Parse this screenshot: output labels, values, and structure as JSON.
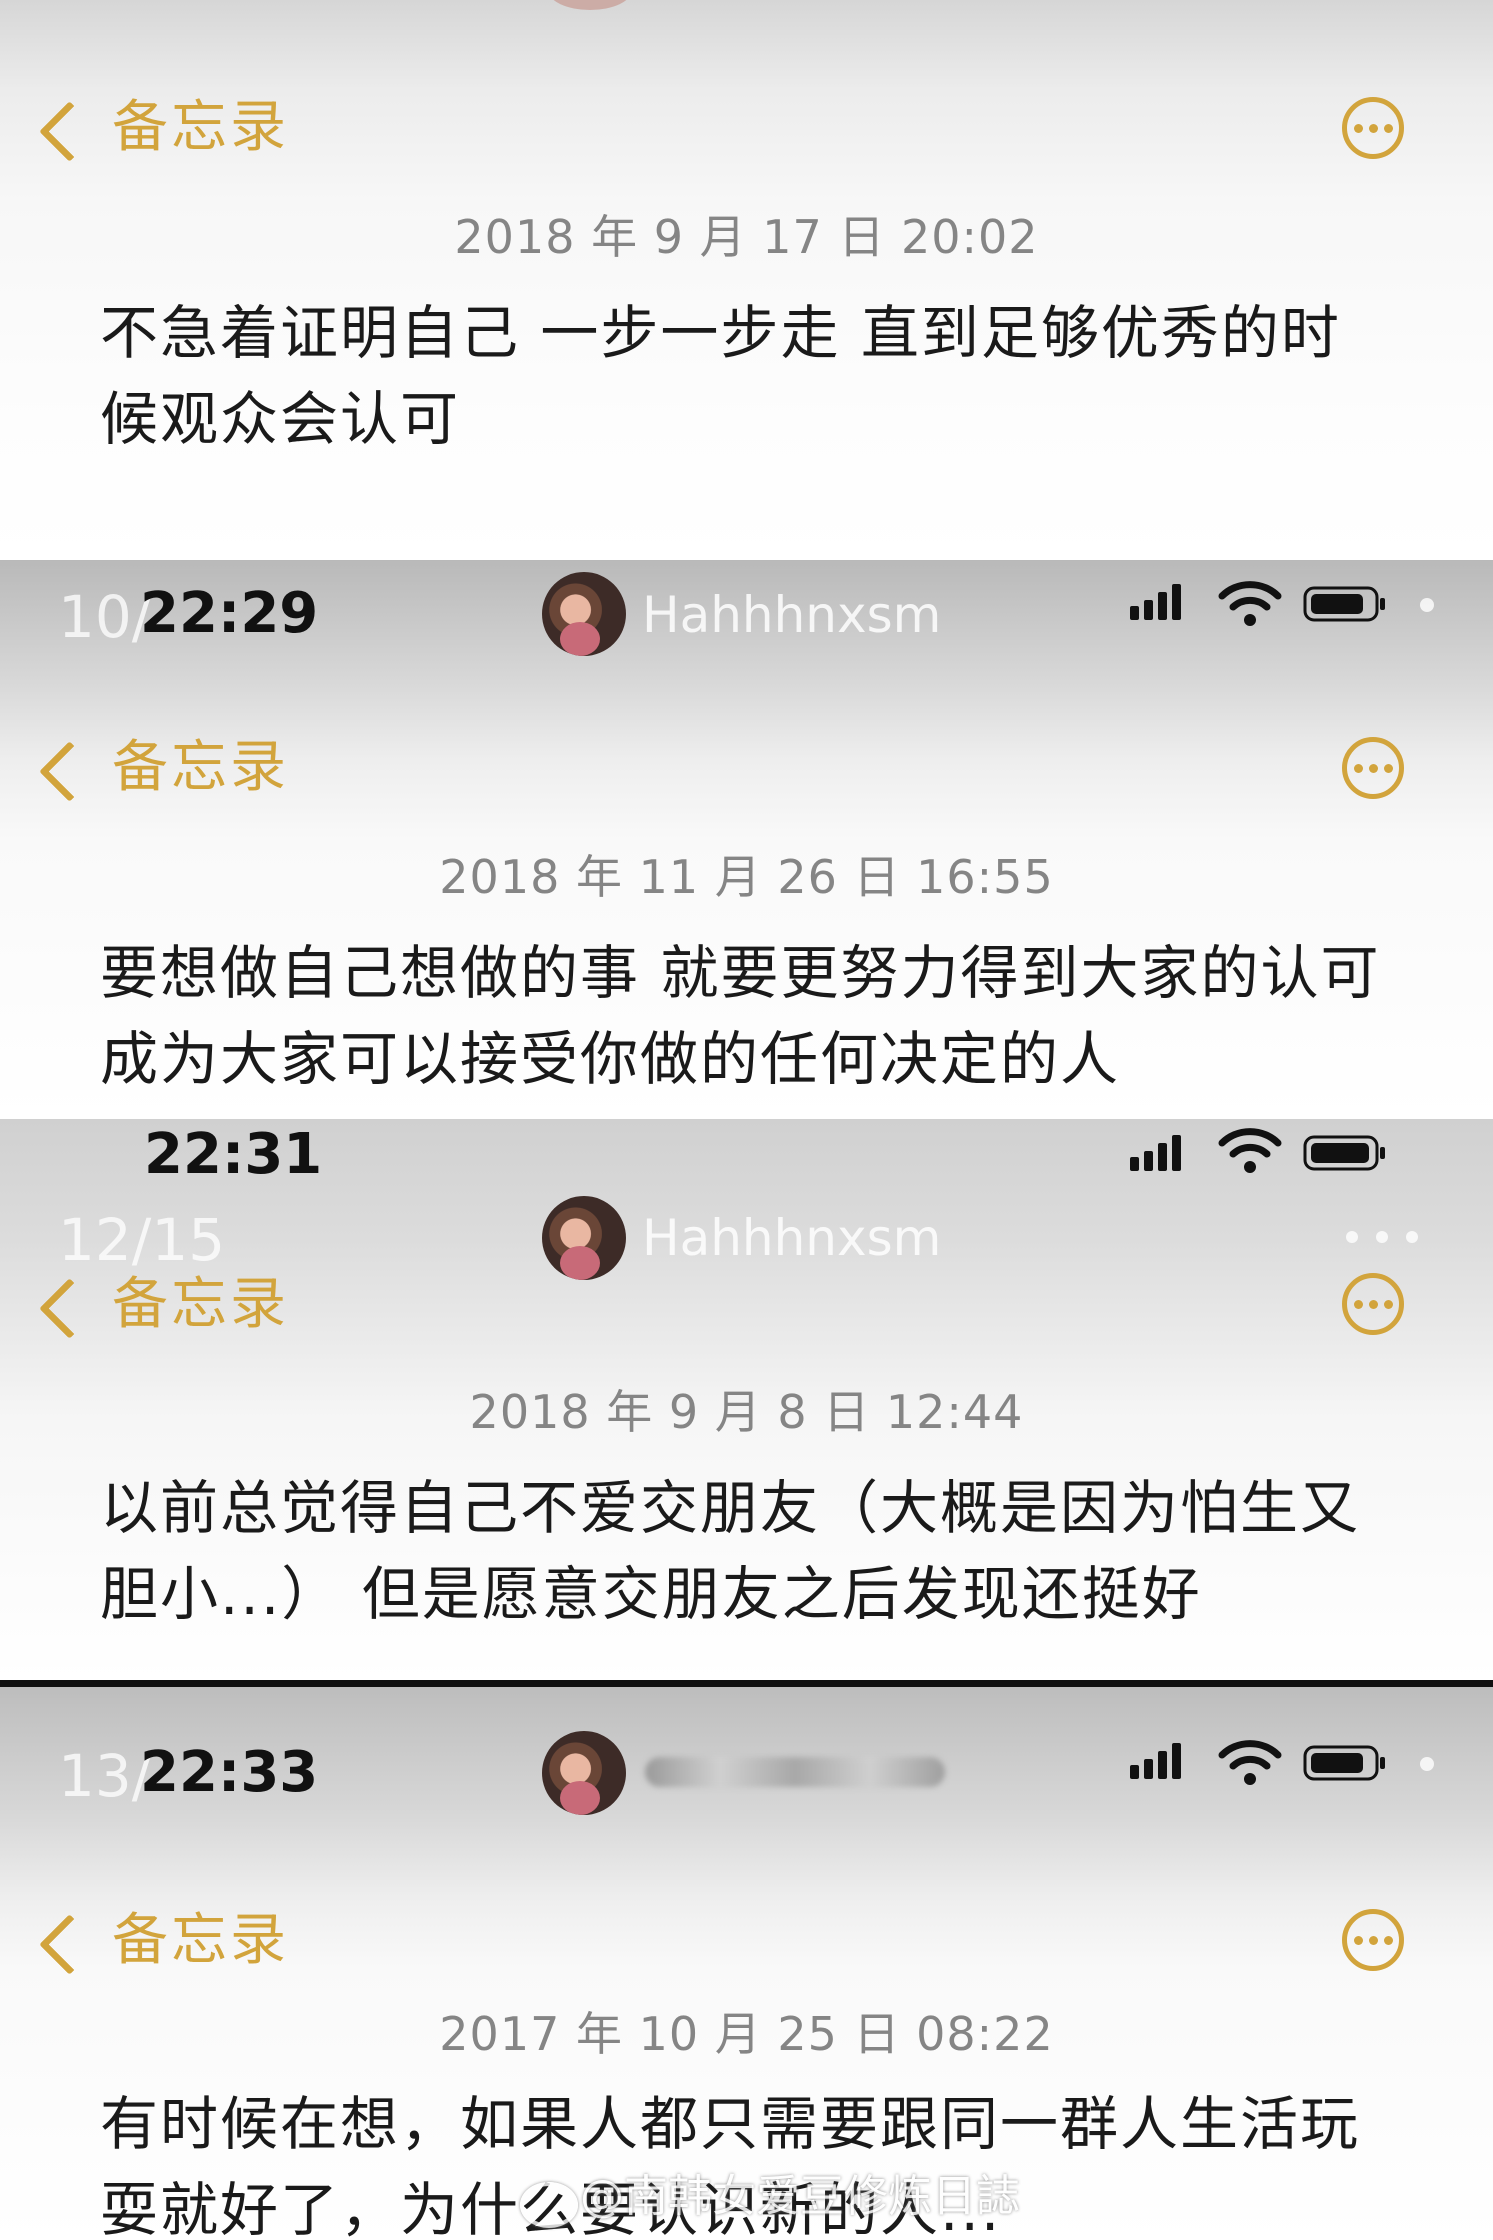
{
  "app": {
    "back_label": "备忘录"
  },
  "panels": [
    {
      "date": "2018 年 9 月 17 日 20:02",
      "note_lines": [
        "不急着证明自己 一步一步走 直到足够优秀的时",
        "候观众会认可"
      ]
    },
    {
      "time": "22:29",
      "page_indicator": "10/",
      "username": "Hahhhnxsm",
      "date": "2018 年 11 月 26 日 16:55",
      "note_lines": [
        "要想做自己想做的事 就要更努力得到大家的认可",
        "成为大家可以接受你做的任何决定的人"
      ]
    },
    {
      "time": "22:31",
      "page_indicator": "12/15",
      "username": "Hahhhnxsm",
      "date": "2018 年 9 月 8 日 12:44",
      "note_lines": [
        "以前总觉得自己不爱交朋友（大概是因为怕生又",
        "胆小...） 但是愿意交朋友之后发现还挺好"
      ]
    },
    {
      "time": "22:33",
      "page_indicator": "13/",
      "date": "2017 年 10 月 25 日 08:22",
      "note_lines": [
        "有时候在想，如果人都只需要跟同一群人生活玩",
        "耍就好了，为什么要认识新的人..."
      ]
    }
  ],
  "watermark": "@南韩女爱豆修炼日誌",
  "icons": {
    "back": "chevron-left-icon",
    "more": "ellipsis-circle-icon",
    "signal": "cellular-signal-icon",
    "wifi": "wifi-icon",
    "battery": "battery-icon"
  },
  "colors": {
    "accent": "#d2a43c",
    "date_text": "#858585",
    "note_text": "#1a1a1a"
  }
}
